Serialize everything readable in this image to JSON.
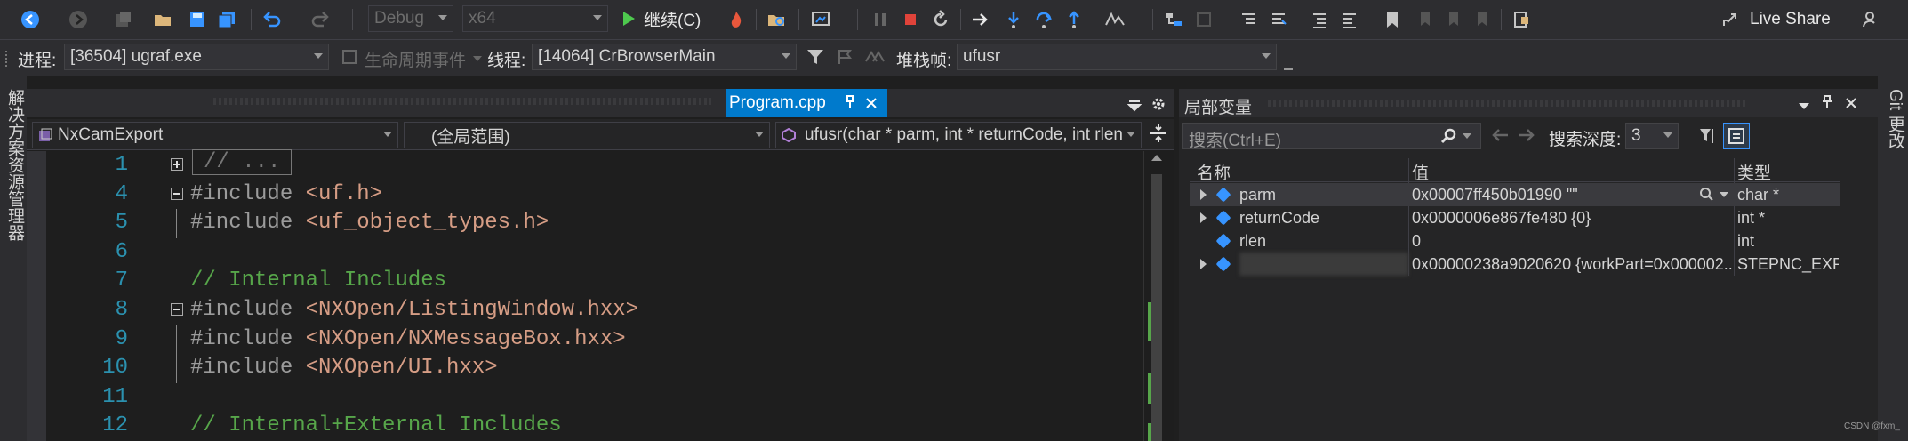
{
  "toolbar": {
    "config_combo": "Debug",
    "platform_combo": "x64",
    "continue_label": "继续(C)",
    "live_share_label": "Live Share"
  },
  "debug_location": {
    "process_label": "进程:",
    "process_value": "[36504] ugraf.exe",
    "lifecycle_label": "生命周期事件",
    "thread_label": "线程:",
    "thread_value": "[14064] CrBrowserMain",
    "stackframe_label": "堆栈帧:",
    "stackframe_value": "ufusr"
  },
  "left_sidebar": {
    "solution_explorer_label": "解决方案资源管理器"
  },
  "right_sidebar": {
    "git_changes_label": "Git 更改"
  },
  "editor": {
    "active_tab": "Program.cpp",
    "nav_project": "NxCamExport",
    "nav_scope": "(全局范围)",
    "nav_function": "ufusr(char * parm, int * returnCode, int rlen",
    "lines": [
      {
        "num": "1",
        "kind": "collapsed",
        "text": "// ..."
      },
      {
        "num": "4",
        "kind": "include",
        "kw": "#include",
        "file": "<uf.h>",
        "fold": "start"
      },
      {
        "num": "5",
        "kind": "include",
        "kw": "#include",
        "file": "<uf_object_types.h>",
        "fold": "mid"
      },
      {
        "num": "6",
        "kind": "blank",
        "text": ""
      },
      {
        "num": "7",
        "kind": "comment",
        "text": "// Internal Includes"
      },
      {
        "num": "8",
        "kind": "include",
        "kw": "#include",
        "file": "<NXOpen/ListingWindow.hxx>",
        "fold": "start"
      },
      {
        "num": "9",
        "kind": "include",
        "kw": "#include",
        "file": "<NXOpen/NXMessageBox.hxx>",
        "fold": "mid"
      },
      {
        "num": "10",
        "kind": "include",
        "kw": "#include",
        "file": "<NXOpen/UI.hxx>",
        "fold": "mid"
      },
      {
        "num": "11",
        "kind": "blank",
        "text": ""
      },
      {
        "num": "12",
        "kind": "comment",
        "text": "// Internal+External Includes"
      }
    ]
  },
  "locals": {
    "title": "局部变量",
    "search_placeholder": "搜索(Ctrl+E)",
    "search_depth_label": "搜索深度:",
    "search_depth_value": "3",
    "columns": {
      "name": "名称",
      "value": "值",
      "type": "类型"
    },
    "rows": [
      {
        "name": "parm",
        "value": "0x00007ff450b01990 \"\"",
        "type": "char *",
        "expandable": true,
        "selected": true
      },
      {
        "name": "returnCode",
        "value": "0x0000006e867fe480 {0}",
        "type": "int *",
        "expandable": true,
        "selected": false
      },
      {
        "name": "rlen",
        "value": "0",
        "type": "int",
        "expandable": false,
        "selected": false
      },
      {
        "name": "",
        "value": "0x00000238a9020620 {workPart=0x000002...",
        "type": "STEPNC_EXP...",
        "expandable": true,
        "selected": false,
        "blurred": true
      }
    ]
  },
  "watermark": "CSDN @fxm_"
}
